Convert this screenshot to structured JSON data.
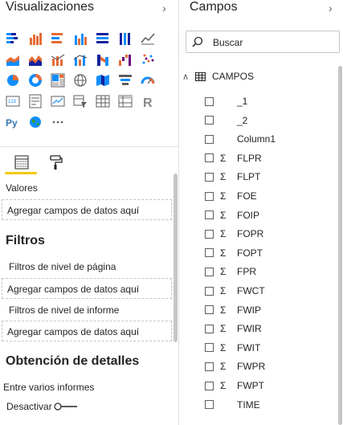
{
  "visualizations": {
    "title": "Visualizaciones",
    "icons": [
      [
        "stacked-bar-icon",
        "clustered-bar-icon",
        "stacked-bar-100-icon",
        "clustered-column-icon",
        "stacked-column-icon",
        "column-100-icon",
        "line-chart-icon"
      ],
      [
        "area-chart-icon",
        "stacked-area-icon",
        "line-clustered-column-icon",
        "line-stacked-column-icon",
        "ribbon-chart-icon",
        "waterfall-chart-icon",
        "scatter-chart-icon"
      ],
      [
        "pie-chart-icon",
        "donut-chart-icon",
        "treemap-icon",
        "map-icon",
        "filled-map-icon",
        "funnel-icon",
        "gauge-icon"
      ],
      [
        "card-icon",
        "multi-row-card-icon",
        "kpi-icon",
        "slicer-icon",
        "table-icon",
        "matrix-icon",
        "r-visual-icon"
      ],
      [
        "python-visual-icon",
        "globe-icon",
        "more-visuals-icon"
      ]
    ],
    "values_label": "Valores",
    "values_well": "Agregar campos de datos aquí",
    "filters_title": "Filtros",
    "page_filters_label": "Filtros de nivel de página",
    "page_filters_well": "Agregar campos de datos aquí",
    "report_filters_label": "Filtros de nivel de informe",
    "report_filters_well": "Agregar campos de datos aquí",
    "drillthrough_title": "Obtención de detalles",
    "cross_report_label": "Entre varios informes",
    "toggle_label": "Desactivar"
  },
  "fields": {
    "title": "Campos",
    "search_placeholder": "Buscar",
    "table_name": "CAMPOS",
    "items": [
      {
        "name": "_1",
        "sigma": false
      },
      {
        "name": "_2",
        "sigma": false
      },
      {
        "name": "Column1",
        "sigma": false
      },
      {
        "name": "FLPR",
        "sigma": true
      },
      {
        "name": "FLPT",
        "sigma": true
      },
      {
        "name": "FOE",
        "sigma": true
      },
      {
        "name": "FOIP",
        "sigma": true
      },
      {
        "name": "FOPR",
        "sigma": true
      },
      {
        "name": "FOPT",
        "sigma": true
      },
      {
        "name": "FPR",
        "sigma": true
      },
      {
        "name": "FWCT",
        "sigma": true
      },
      {
        "name": "FWIP",
        "sigma": true
      },
      {
        "name": "FWIR",
        "sigma": true
      },
      {
        "name": "FWIT",
        "sigma": true
      },
      {
        "name": "FWPR",
        "sigma": true
      },
      {
        "name": "FWPT",
        "sigma": true
      },
      {
        "name": "TIME",
        "sigma": false
      }
    ]
  },
  "colors": {
    "accent": "#f2c811",
    "viz_orange": "#e66c37",
    "viz_blue": "#118dff",
    "viz_dark": "#12239e",
    "viz_purple": "#6b007b"
  }
}
